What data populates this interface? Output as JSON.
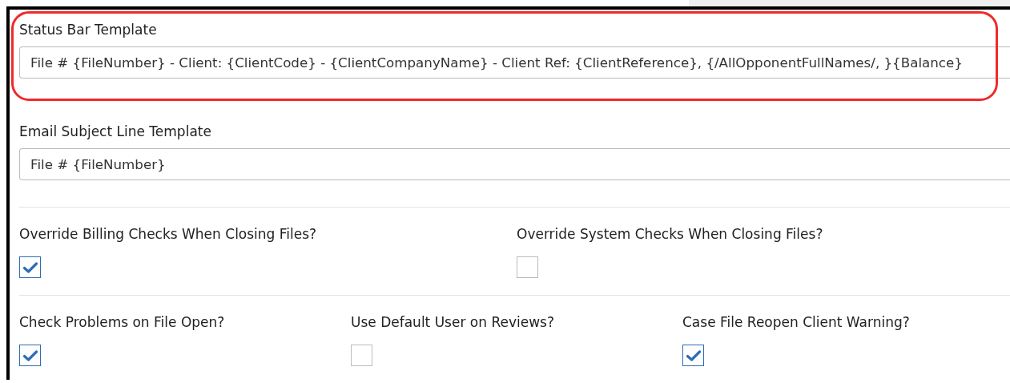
{
  "text_fields": [
    {
      "label": "Status Bar Template",
      "value": "File # {FileNumber} - Client: {ClientCode} - {ClientCompanyName} - Client Ref: {ClientReference}, {/AllOpponentFullNames/, }{Balance}",
      "highlighted": true
    },
    {
      "label": "Email Subject Line Template",
      "value": "File # {FileNumber}",
      "highlighted": false
    }
  ],
  "checkbox_rows": [
    [
      {
        "label": "Override Billing Checks When Closing Files?",
        "checked": true
      },
      {
        "label": "Override System Checks When Closing Files?",
        "checked": false
      }
    ],
    [
      {
        "label": "Check Problems on File Open?",
        "checked": true
      },
      {
        "label": "Use Default User on Reviews?",
        "checked": false
      },
      {
        "label": "Case File Reopen Client Warning?",
        "checked": true
      }
    ]
  ]
}
